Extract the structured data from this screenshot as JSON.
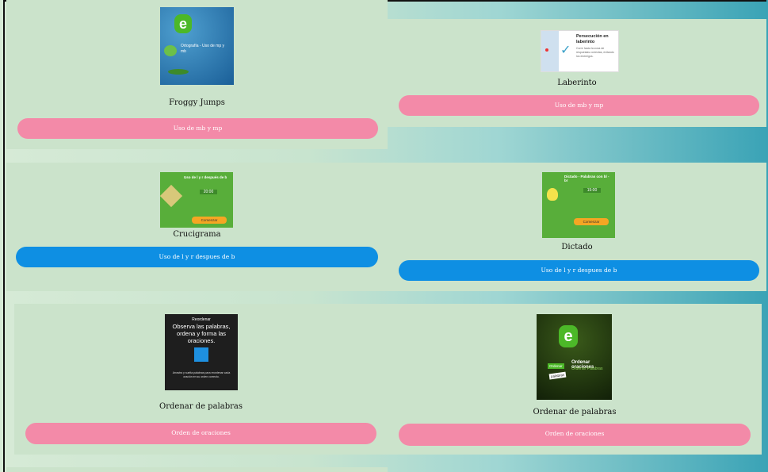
{
  "cards": [
    {
      "title": "Froggy Jumps",
      "button": "Uso de mb y mp",
      "thumb_text": "Ortografía - Uso de mp y mb"
    },
    {
      "title": "Laberinto",
      "button": "Uso de mb y mp",
      "thumb_title": "Persecución en laberinto",
      "thumb_sub": "Corre hacia la zona de respuestas correctas, evitando los enemigos."
    },
    {
      "title": "Crucigrama",
      "button": "Uso de l y r despues de b",
      "thumb_title": "Uso de l y r después de b",
      "thumb_time": "20:00",
      "thumb_btn": "Comenzar"
    },
    {
      "title": "Dictado",
      "button": "Uso de l y r despues de b",
      "thumb_title": "Dictado - Palabras con bl - br",
      "thumb_time": "15:00",
      "thumb_btn": "Comenzar"
    },
    {
      "title": "Ordenar de palabras",
      "button": "Orden de oraciones",
      "thumb_line1": "Reordenar",
      "thumb_line2": "Observa las palabras, ordena y forma las oraciones.",
      "thumb_line3": "Arrastra y suelta palabras para reordenar cada oración en su orden correcto."
    },
    {
      "title": "Ordenar de palabras",
      "button": "Orden de oraciones",
      "thumb_title": "Ordenar oraciones",
      "thumb_sub": "Ordenar Palabras",
      "thumb_tag1": "Ordenar",
      "thumb_tag2": "palabras"
    }
  ],
  "colors": {
    "pink": "#f38aa8",
    "blue": "#0e8fe3",
    "card": "#cbe3cb",
    "green_thumb": "#58ae3a"
  }
}
